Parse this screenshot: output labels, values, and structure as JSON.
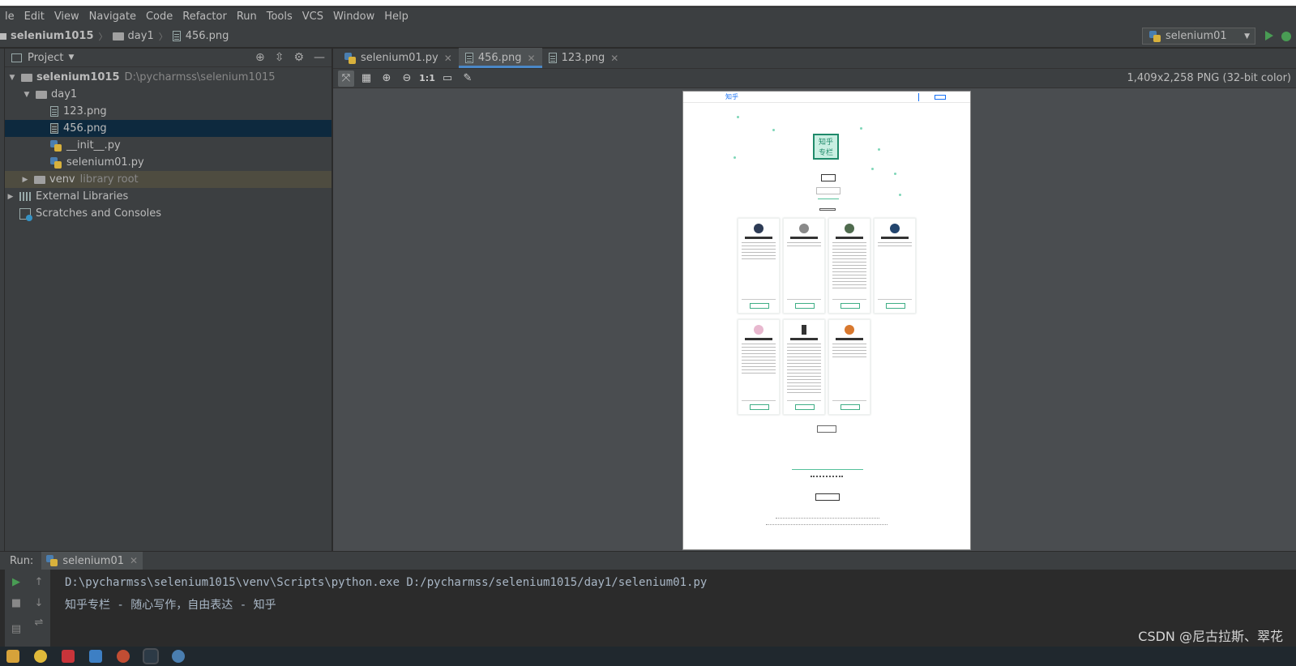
{
  "menu": [
    "le",
    "Edit",
    "View",
    "Navigate",
    "Code",
    "Refactor",
    "Run",
    "Tools",
    "VCS",
    "Window",
    "Help"
  ],
  "breadcrumb": {
    "project": "selenium1015",
    "folder": "day1",
    "file": "456.png"
  },
  "run_config": {
    "label": "selenium01"
  },
  "project_panel": {
    "title": "Project",
    "tree": {
      "root": "selenium1015",
      "root_path": "D:\\pycharmss\\selenium1015",
      "folder": "day1",
      "files": [
        "123.png",
        "456.png",
        "__init__.py",
        "selenium01.py"
      ],
      "venv": "venv",
      "venv_note": "library root",
      "external": "External Libraries",
      "scratches": "Scratches and Consoles"
    }
  },
  "editor": {
    "tabs": [
      {
        "label": "selenium01.py",
        "active": false
      },
      {
        "label": "456.png",
        "active": true
      },
      {
        "label": "123.png",
        "active": false
      }
    ],
    "image_info": "1,409x2,258 PNG (32-bit color)",
    "toolbar": {
      "zoom_actual": "1:1"
    }
  },
  "preview": {
    "brand": "知乎",
    "logo_line1": "知乎",
    "logo_line2": "专栏"
  },
  "run_panel": {
    "label": "Run:",
    "tab": "selenium01",
    "output": [
      "D:\\pycharmss\\selenium1015\\venv\\Scripts\\python.exe D:/pycharmss/selenium1015/day1/selenium01.py",
      "知乎专栏 - 随心写作，自由表达 - 知乎"
    ]
  },
  "watermark": "CSDN @尼古拉斯、翠花",
  "colors": {
    "accent": "#4a88c7",
    "selection": "#0d293e",
    "run_green": "#499c54"
  }
}
